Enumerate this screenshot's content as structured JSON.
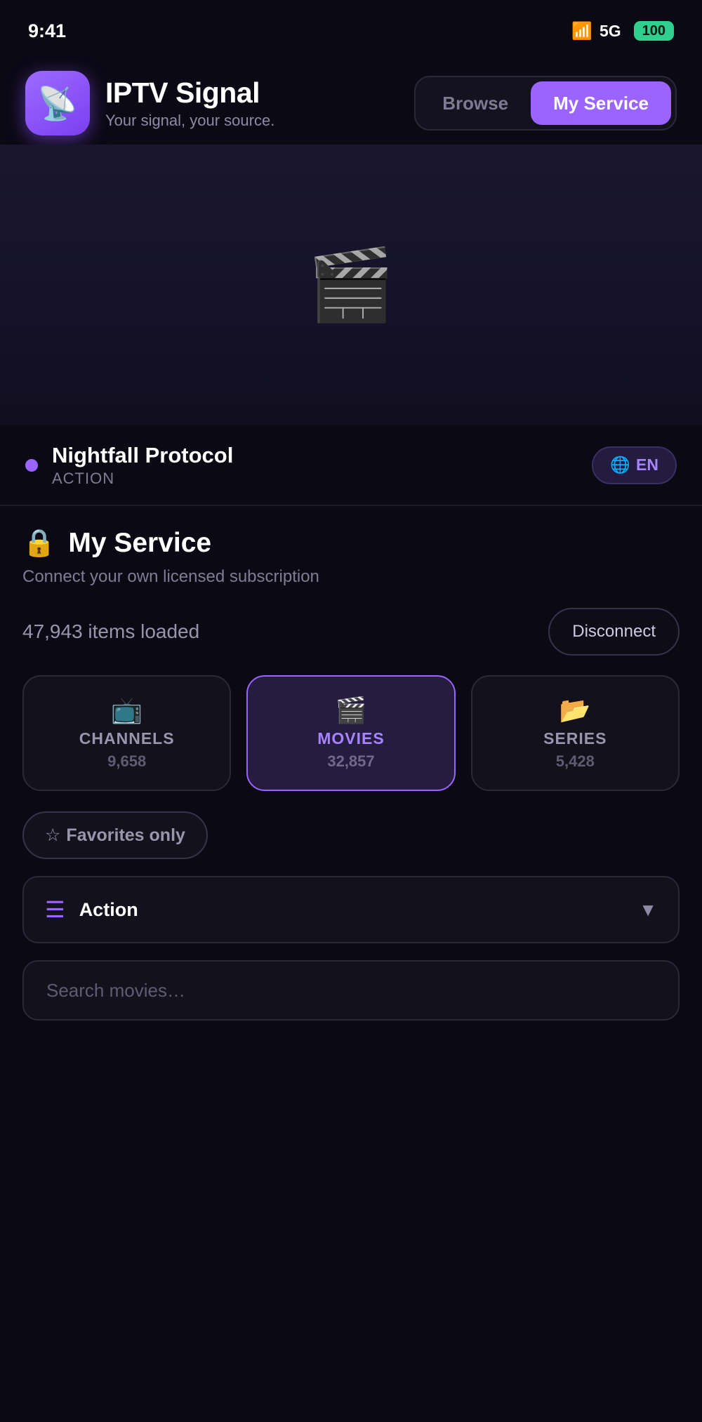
{
  "status_bar": {
    "time": "9:41",
    "signal_icon": "signal-bars-icon",
    "network": "5G",
    "battery": "100"
  },
  "header": {
    "logo_icon": "satellite-dish-icon",
    "title": "IPTV Signal",
    "subtitle": "Your signal, your source.",
    "tabs": [
      {
        "label": "Browse",
        "active": false
      },
      {
        "label": "My Service",
        "active": true
      }
    ]
  },
  "hero": {
    "icon": "clapper-board-icon"
  },
  "now_playing": {
    "title": "Nightfall Protocol",
    "genre": "ACTION",
    "language": "EN",
    "language_icon": "globe-icon"
  },
  "section": {
    "icon": "lock-icon",
    "title": "My Service",
    "subtitle": "Connect your own licensed subscription",
    "items_loaded": "47,943 items loaded",
    "disconnect_label": "Disconnect"
  },
  "categories": [
    {
      "icon": "tv-icon",
      "label": "CHANNELS",
      "count": "9,658",
      "active": false
    },
    {
      "icon": "clapper-board-icon",
      "label": "MOVIES",
      "count": "32,857",
      "active": true
    },
    {
      "icon": "folder-icon",
      "label": "SERIES",
      "count": "5,428",
      "active": false
    }
  ],
  "favorites": {
    "icon": "star-icon",
    "label": "Favorites only"
  },
  "genre_select": {
    "icon": "list-icon",
    "value": "Action"
  },
  "search": {
    "placeholder": "Search movies…",
    "value": ""
  },
  "colors": {
    "accent": "#9b63ff",
    "background": "#0b0914",
    "battery": "#2ecf8f"
  }
}
